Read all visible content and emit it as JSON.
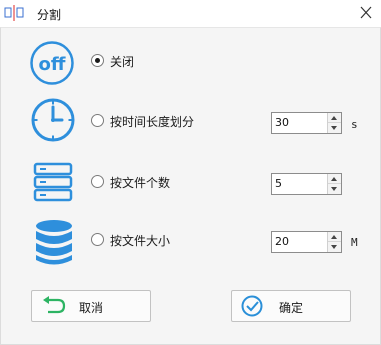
{
  "window": {
    "title": "分割",
    "close_icon": "close-icon",
    "app_icon": "split-view-icon"
  },
  "options": [
    {
      "icon": "off-icon",
      "label": "关闭",
      "checked": true
    },
    {
      "icon": "clock-icon",
      "label": "按时间长度划分",
      "checked": false,
      "value": "30",
      "unit": "s"
    },
    {
      "icon": "server-icon",
      "label": "按文件个数",
      "checked": false,
      "value": "5",
      "unit": ""
    },
    {
      "icon": "database-icon",
      "label": "按文件大小",
      "checked": false,
      "value": "20",
      "unit": "M"
    }
  ],
  "off_icon_text": "off",
  "buttons": {
    "cancel": {
      "label": "取消",
      "icon": "return-arrow-icon"
    },
    "ok": {
      "label": "确定",
      "icon": "check-circle-icon"
    }
  },
  "colors": {
    "accent": "#2e8fdc",
    "cancel_icon": "#2db463",
    "ok_icon": "#2a8fd8"
  }
}
